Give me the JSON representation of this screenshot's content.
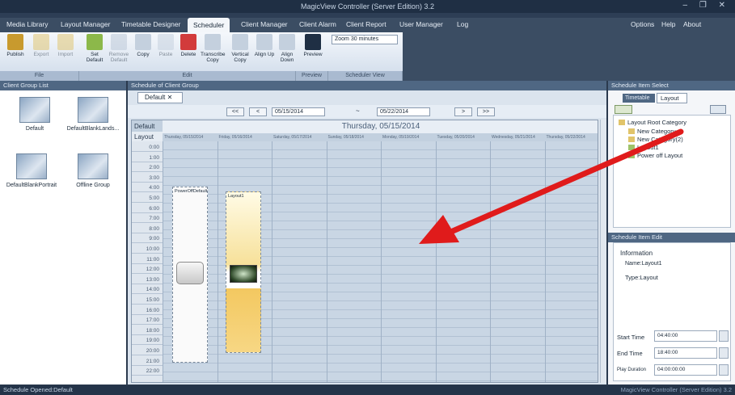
{
  "window": {
    "title": "MagicView Controller (Server Edition) 3.2",
    "controls": "– ❐ ✕"
  },
  "menu": {
    "items": [
      "Media Library",
      "Layout Manager",
      "Timetable Designer",
      "Scheduler",
      "Client Manager",
      "Client Alarm",
      "Client Report",
      "User Manager",
      "Log"
    ],
    "active_index": 3,
    "right_items": [
      "Options",
      "Help",
      "About"
    ]
  },
  "ribbon": {
    "buttons": [
      "Publish",
      "Export",
      "Import",
      "Set Default",
      "Remove Default",
      "Copy",
      "Paste",
      "Delete",
      "Transcribe Copy",
      "Vertical Copy",
      "Align Up",
      "Align Down",
      "Preview"
    ],
    "zoom_label": "Zoom 30 minutes",
    "groups": [
      "File",
      "Edit",
      "Preview",
      "Scheduler View"
    ]
  },
  "left": {
    "title": "Client Group List",
    "groups": [
      "Default",
      "DefaultBlankLands...",
      "DefaultBlankPortrait",
      "Offline Group"
    ]
  },
  "center": {
    "title": "Schedule of Client Group",
    "tab": "Default",
    "nav_first": "<<",
    "nav_prev": "<",
    "start_date": "05/15/2014",
    "dash": "~",
    "end_date": "05/22/2014",
    "nav_next": ">",
    "nav_last": ">>",
    "day_title": "Thursday, 05/15/2014",
    "row_labels": [
      "Default",
      "Layout"
    ],
    "day_headers": [
      "Thursday, 05/15/2014",
      "Friday, 05/16/2014",
      "Saturday, 05/17/2014",
      "Sunday, 05/18/2014",
      "Monday, 05/19/2014",
      "Tuesday, 05/20/2014",
      "Wednesday, 05/21/2014",
      "Thursday, 05/22/2014"
    ],
    "times": [
      "0:00",
      "1:00",
      "2:00",
      "3:00",
      "4:00",
      "5:00",
      "6:00",
      "7:00",
      "8:00",
      "9:00",
      "10:00",
      "11:00",
      "12:00",
      "13:00",
      "14:00",
      "15:00",
      "16:00",
      "17:00",
      "18:00",
      "19:00",
      "20:00",
      "21:00",
      "22:00"
    ],
    "block1_label": "PowerOffDefault",
    "block2_label": "Layout1"
  },
  "right": {
    "title": "Schedule Item Select",
    "tabs": [
      "Timetable",
      "Layout"
    ],
    "tree": [
      "Layout Root Category",
      "New Category",
      "New Category(2)",
      "Layout1",
      "Power off Layout"
    ],
    "edit_title": "Schedule Item Edit",
    "info_label": "Information",
    "name_line": "Name:Layout1",
    "type_line": "Type:Layout",
    "start_label": "Start Time",
    "start_value": "04:40:00",
    "end_label": "End Time",
    "end_value": "18:40:00",
    "duration_label": "Play Duration",
    "duration_value": "04:00:00:00"
  },
  "status": {
    "left": "Schedule Opened:Default",
    "right": "MagicView Controller (Server Edition) 3.2"
  },
  "colors": {
    "accent_arrow": "#e01b1b",
    "titlebar": "#1f2f44",
    "ribbon_active_tab": "#f3f6fa"
  },
  "icons": {
    "arrow": "red-arrow-annotation"
  }
}
